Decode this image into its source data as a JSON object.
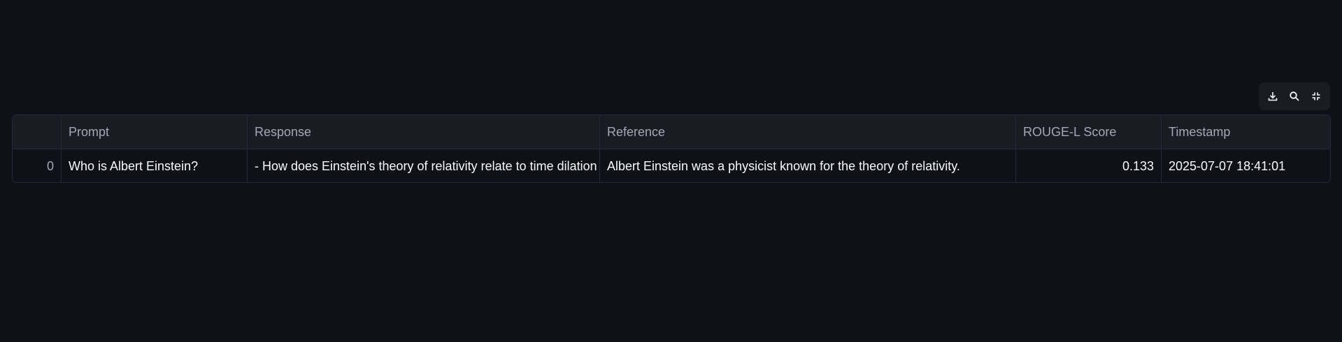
{
  "toolbar": {
    "download_icon": "download-icon",
    "search_icon": "search-icon",
    "fullscreen_icon": "fullscreen-exit-icon"
  },
  "table": {
    "columns": [
      "",
      "Prompt",
      "Response",
      "Reference",
      "ROUGE-L Score",
      "Timestamp"
    ],
    "rows": [
      {
        "index": "0",
        "prompt": "Who is Albert Einstein?",
        "response": "- How does Einstein's theory of relativity relate to time dilation",
        "reference": "Albert Einstein was a physicist known for the theory of relativity.",
        "score": "0.133",
        "timestamp": "2025-07-07 18:41:01"
      }
    ]
  },
  "colors": {
    "background": "#0e1117",
    "header_bg": "#1a1c24",
    "border": "#262832",
    "text": "#fafafa",
    "muted_text": "#a3a8b4"
  }
}
